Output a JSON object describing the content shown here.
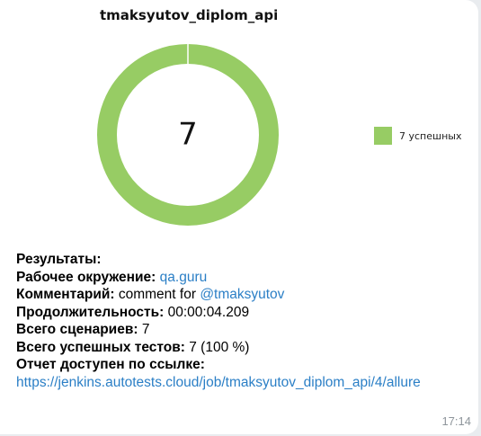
{
  "chart_data": {
    "type": "pie",
    "title": "tmaksyutov_diplom_api",
    "center_label": "7",
    "slices": [
      {
        "name": "7 успешных",
        "value": 7,
        "color": "#97cc64"
      }
    ],
    "legend_position": "right"
  },
  "message": {
    "results_label": "Результаты:",
    "env_label": "Рабочее окружение:",
    "env_value": "qa.guru",
    "comment_label": "Комментарий:",
    "comment_text": "comment for",
    "comment_mention": "@tmaksyutov",
    "duration_label": "Продолжительность:",
    "duration_value": "00:00:04.209",
    "total_label": "Всего сценариев:",
    "total_value": "7",
    "passed_label": "Всего успешных тестов:",
    "passed_value": "7 (100 %)",
    "report_label": "Отчет доступен по ссылке:",
    "report_url": "https://jenkins.autotests.cloud/job/tmaksyutov_diplom_api/4/allure",
    "time": "17:14"
  }
}
